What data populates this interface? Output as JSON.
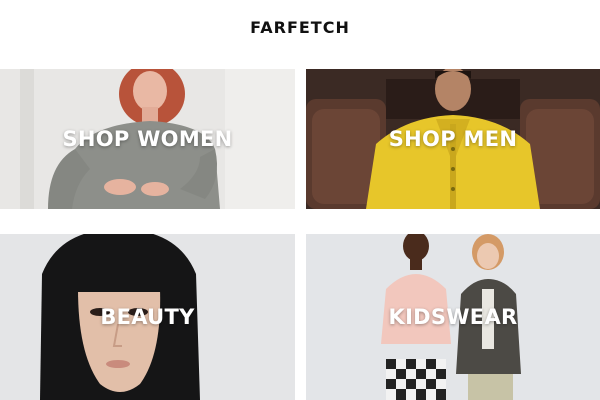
{
  "header": {
    "logo": "FARFETCH"
  },
  "tiles": [
    {
      "label": "SHOP WOMEN"
    },
    {
      "label": "SHOP MEN"
    },
    {
      "label": "BEAUTY"
    },
    {
      "label": "KIDSWEAR"
    }
  ]
}
